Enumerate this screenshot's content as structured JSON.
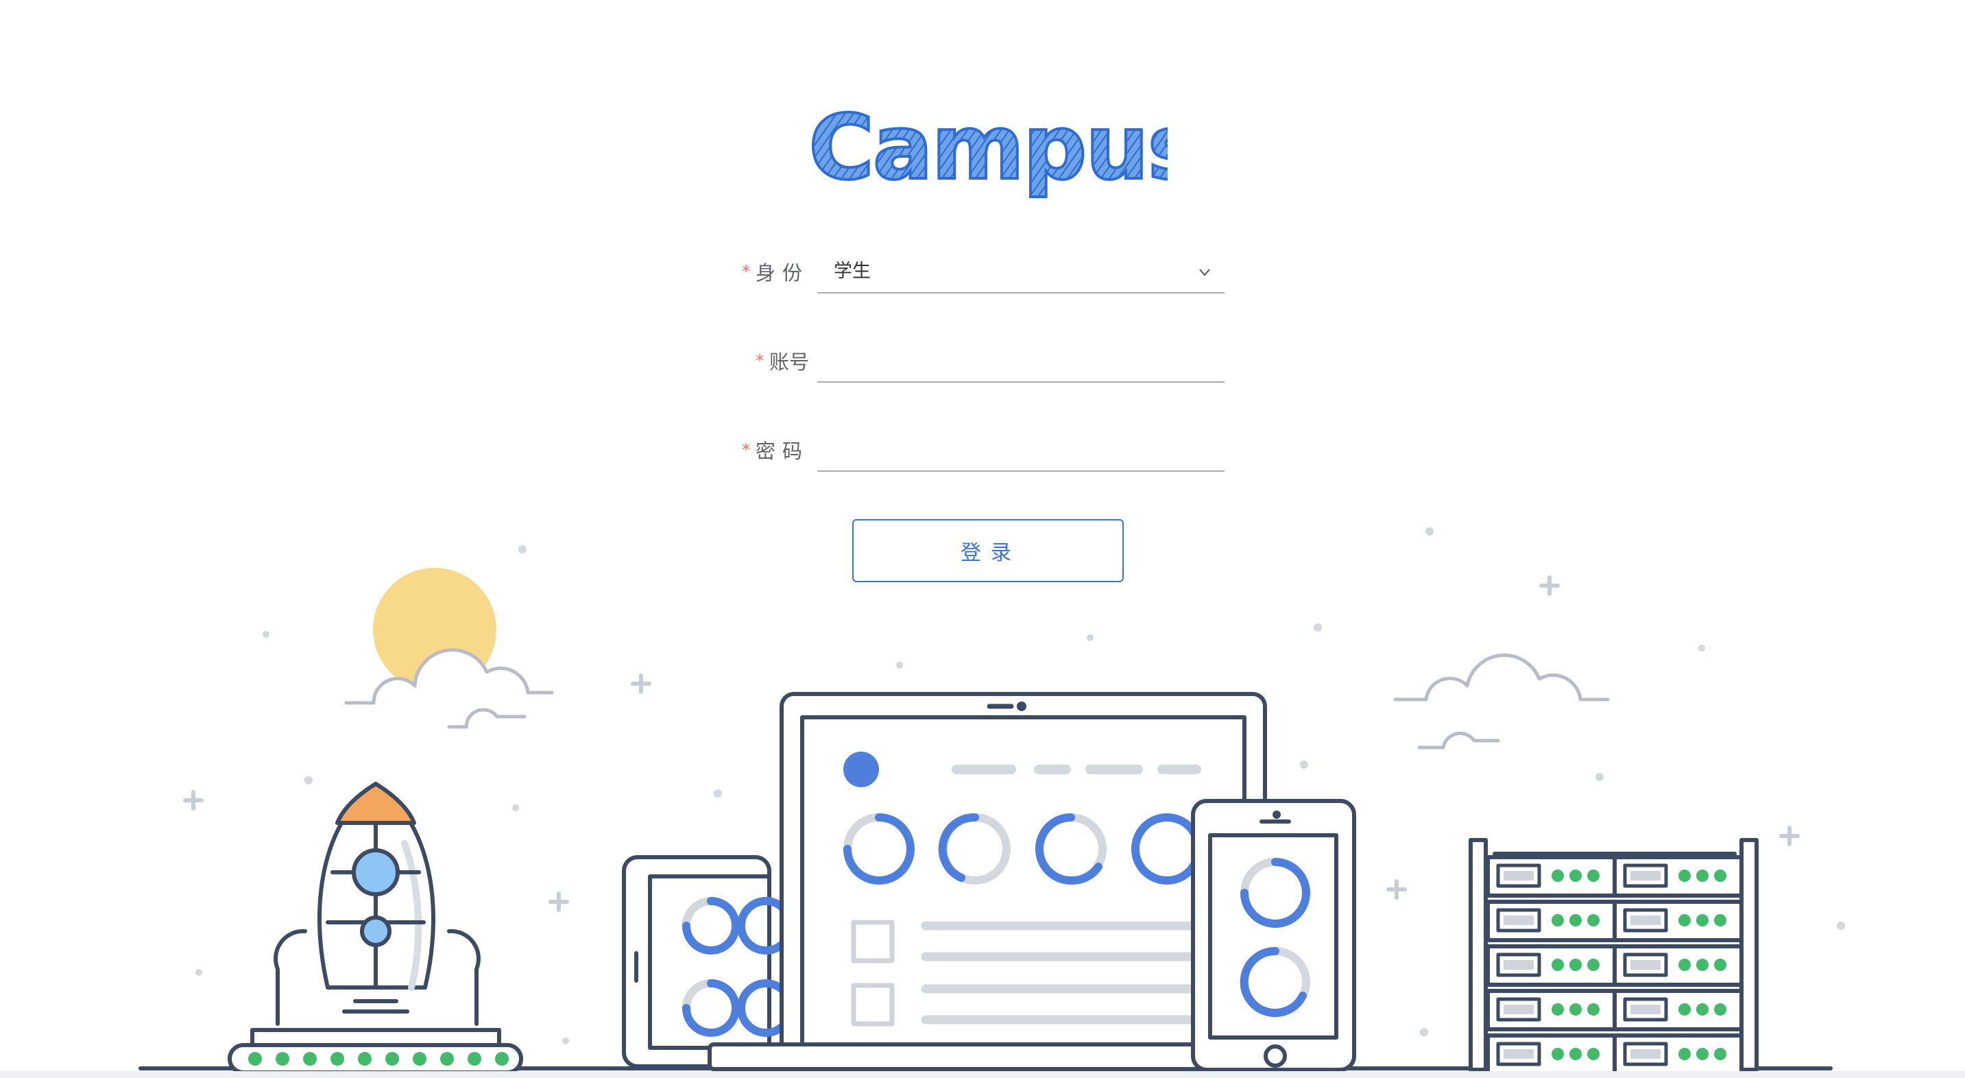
{
  "app": {
    "logo_text": "iCampus",
    "brand_color": "#3a7bd5"
  },
  "form": {
    "required_mark": "*",
    "identity": {
      "label": "身份",
      "value": "学生"
    },
    "account": {
      "label": "账号",
      "value": ""
    },
    "password": {
      "label": "密码",
      "value": ""
    }
  },
  "login_button": {
    "label": "登录"
  },
  "illustration": {
    "colors": {
      "outline": "#3d4a63",
      "accent_blue": "#4f7fdc",
      "light_blue": "#8fc5f5",
      "sun": "#f8d98a",
      "rocket_tip": "#f2a65e",
      "led_green": "#43b96a",
      "gray": "#cfd3db"
    }
  }
}
